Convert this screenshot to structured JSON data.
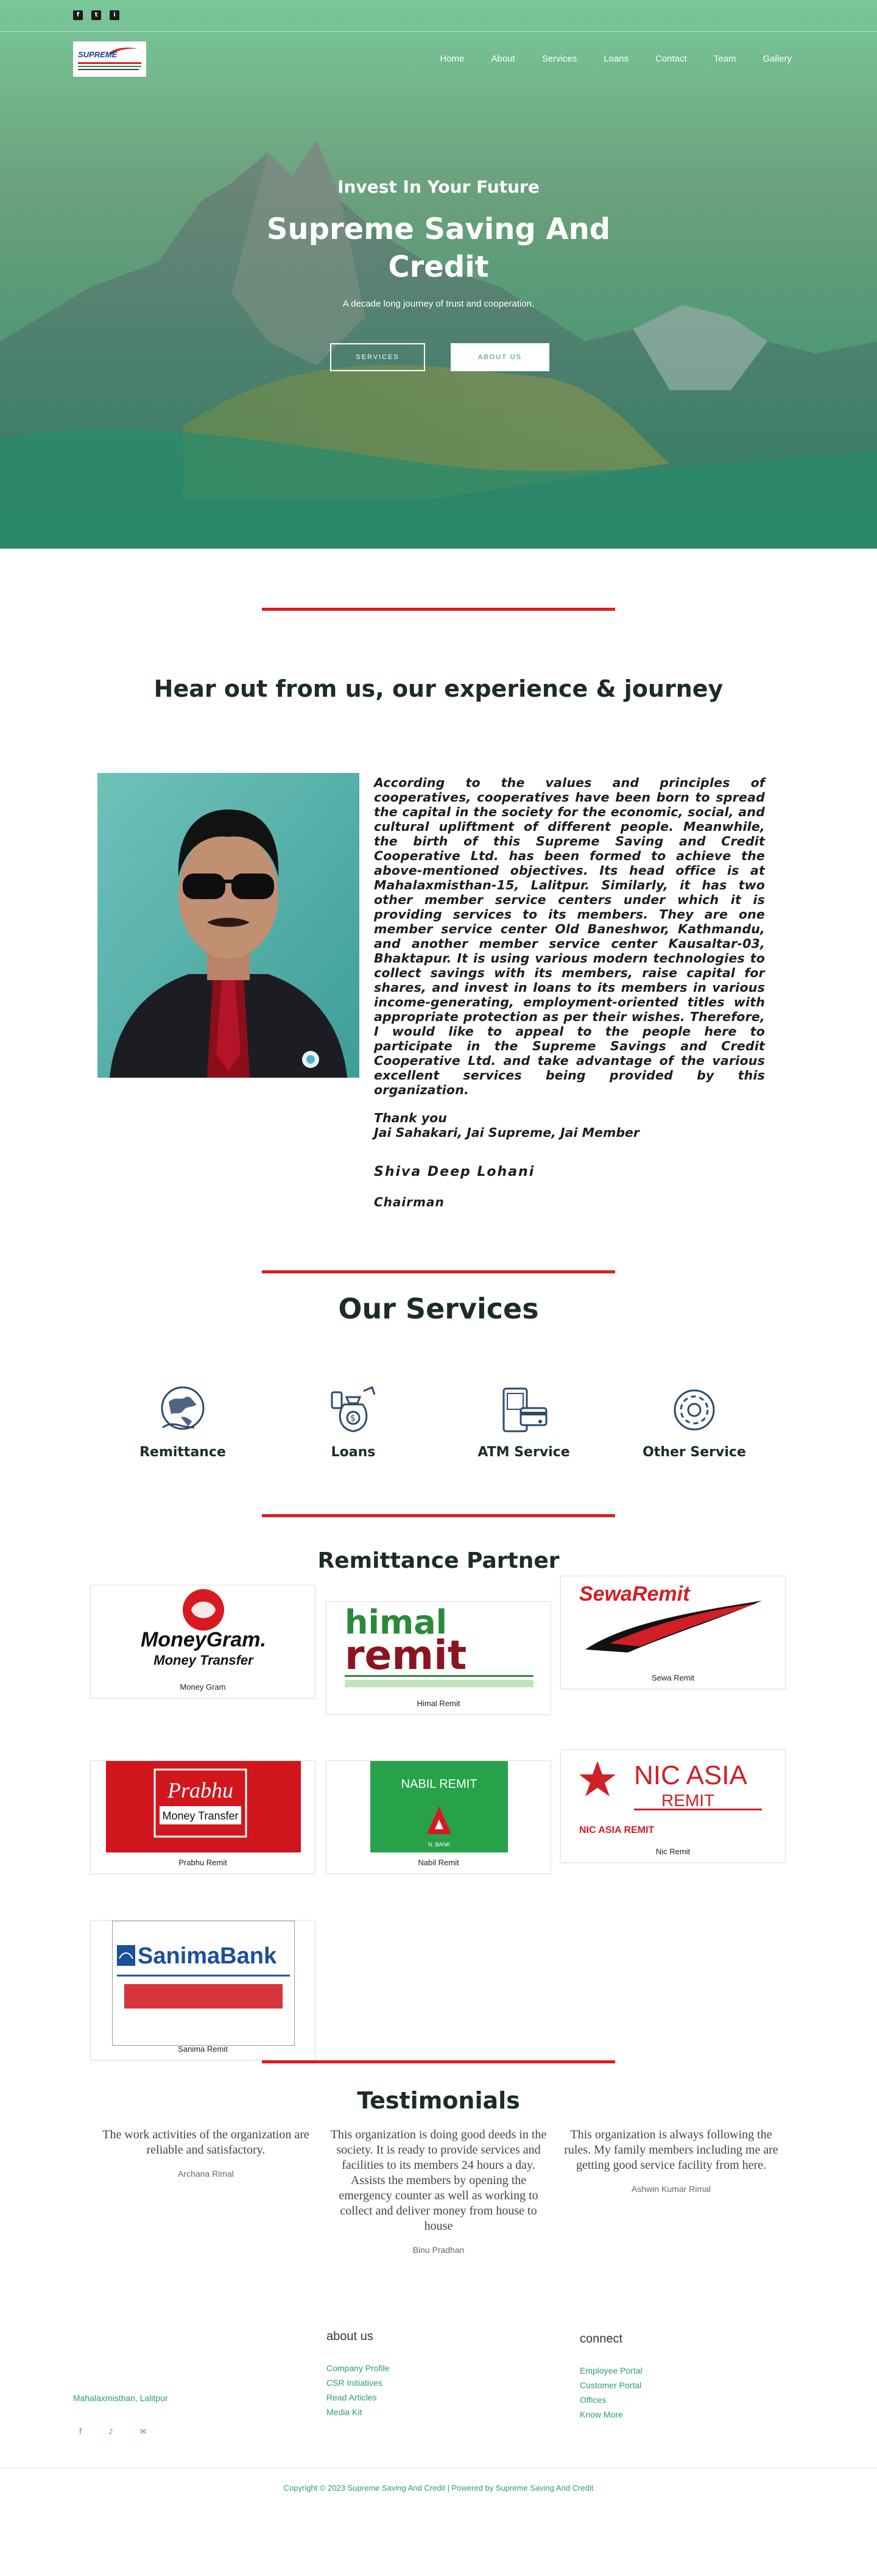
{
  "topbar": {
    "social": [
      "f",
      "t",
      "i"
    ]
  },
  "logo": {
    "text": "SUPREME"
  },
  "nav": {
    "items": [
      "Home",
      "About",
      "Services",
      "Loans",
      "Contact",
      "Team",
      "Gallery"
    ]
  },
  "hero": {
    "kicker": "Invest In Your Future",
    "title": "Supreme Saving And Credit",
    "tagline": "A decade long journey of trust and cooperation.",
    "btn_services": "SERVICES",
    "btn_about": "ABOUT US"
  },
  "message": {
    "heading": "Hear out from us, our experience & journey",
    "body": "According to the values and principles of cooperatives, cooperatives have been born to spread the capital in the society for the economic, social, and cultural upliftment of different people. Meanwhile, the birth of this Supreme Saving and Credit Cooperative Ltd. has been formed to achieve the above-mentioned objectives. Its head office is at Mahalaxmisthan-15, Lalitpur. Similarly, it has two other member service centers under which it is providing services to its members. They are one member service center Old Baneshwor, Kathmandu, and another member service center Kausaltar-03, Bhaktapur. It is using various modern technologies to collect savings with its members, raise capital for shares, and invest in loans to its members in various income-generating, employment-oriented titles with appropriate protection as per their wishes. Therefore, I would like to appeal to the people here to participate in the Supreme Savings and Credit Cooperative Ltd. and take advantage of the various excellent services being provided by this organization.",
    "thanks": "Thank you",
    "slogan": "Jai Sahakari, Jai Supreme, Jai Member",
    "name": "Shiva Deep Lohani",
    "role": "Chairman"
  },
  "services": {
    "title": "Our Services",
    "items": [
      {
        "label": "Remittance",
        "icon": "globe-hand-icon"
      },
      {
        "label": "Loans",
        "icon": "money-bag-icon"
      },
      {
        "label": "ATM Service",
        "icon": "atm-card-icon"
      },
      {
        "label": "Other Service",
        "icon": "gear-icon"
      }
    ]
  },
  "remittance": {
    "title": "Remittance Partner",
    "partners": [
      {
        "name": "Money Gram",
        "logo_text": "MoneyGram.",
        "logo_sub": "Money Transfer"
      },
      {
        "name": "Himal Remit",
        "logo_text": "himal",
        "logo_sub": "remit"
      },
      {
        "name": "Sewa Remit",
        "logo_text": "SewaRemit"
      },
      {
        "name": "Prabhu Remit",
        "logo_text": "Prabhu",
        "logo_sub": "Money Transfer"
      },
      {
        "name": "Nabil Remit",
        "logo_text": "NABIL REMIT",
        "logo_sub": "N. BANK"
      },
      {
        "name": "Nic Remit",
        "logo_text": "NIC ASIA",
        "logo_sub": "REMIT",
        "logo_sub2": "NIC ASIA REMIT"
      },
      {
        "name": "Sanima Remit",
        "logo_text": "SanimaBank"
      }
    ]
  },
  "testimonials": {
    "title": "Testimonials",
    "items": [
      {
        "text": "The work activities of the organization are reliable and satisfactory.",
        "author": "Archana Rimal"
      },
      {
        "text": "This organization is doing good deeds in the society. It is ready to provide services and facilities to its members 24 hours a day. Assists the members by opening the emergency counter as well as working to collect and deliver money from house to house",
        "author": "Binu Pradhan"
      },
      {
        "text": "This organization is always following the rules. My family members including me are getting good service facility from here.",
        "author": "Ashwin Kumar Rimal"
      }
    ]
  },
  "footer": {
    "address": "Mahalaxmisthan, Lalitpur",
    "about_title": "about us",
    "about_links": [
      "Company Profile",
      "CSR Initiatives",
      "Read Articles",
      "Media Kit"
    ],
    "connect_title": "connect",
    "connect_links": [
      "Employee Portal",
      "Customer Portal",
      "Offices",
      "Know More"
    ],
    "copyright": "Copyright © 2023 Supreme Saving And Credit | Powered by Supreme Saving And Credit"
  },
  "colors": {
    "accent_green": "#2a9d6f",
    "red_rule": "#e11c1c",
    "heading": "#1d2b2a"
  }
}
